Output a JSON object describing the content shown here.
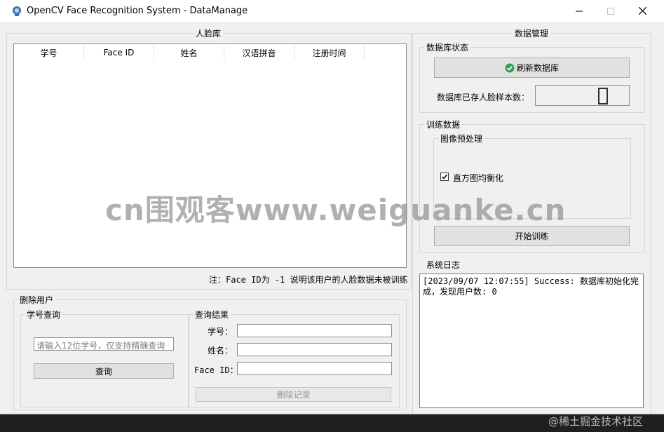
{
  "window": {
    "title": "OpenCV Face Recognition System - DataManage"
  },
  "face_db": {
    "title": "人脸库",
    "columns": [
      "学号",
      "Face ID",
      "姓名",
      "汉语拼音",
      "注册时间"
    ],
    "rows": [],
    "note": "注：Face ID为 -1 说明该用户的人脸数据未被训练"
  },
  "delete_user": {
    "title": "删除用户",
    "query": {
      "title": "学号查询",
      "placeholder": "请输入12位学号，仅支持精确查询",
      "button": "查询"
    },
    "result": {
      "title": "查询结果",
      "labels": {
        "student_id": "学号：",
        "name": "姓名：",
        "face_id": "Face ID："
      },
      "values": {
        "student_id": "",
        "name": "",
        "face_id": ""
      },
      "delete_button": "删除记录"
    }
  },
  "data_manage": {
    "title": "数据管理",
    "db_status": {
      "title": "数据库状态",
      "refresh_button": "刷新数据库",
      "sample_count_label": "数据库已存人脸样本数：",
      "sample_count": "0"
    },
    "training": {
      "title": "训练数据",
      "preprocess": {
        "title": "图像预处理",
        "hist_eq_label": "直方图均衡化",
        "hist_eq_checked": true
      },
      "start_button": "开始训练"
    },
    "log": {
      "title": "系统日志",
      "text": "[2023/09/07 12:07:55] Success: 数据库初始化完成，发现用户数: 0"
    }
  },
  "overlay": {
    "watermark": "cn围观客www.weiguanke.cn",
    "footer": "@稀土掘金技术社区"
  },
  "colors": {
    "success_icon": "#2ea44f",
    "window_bg": "#f0f0f0"
  }
}
